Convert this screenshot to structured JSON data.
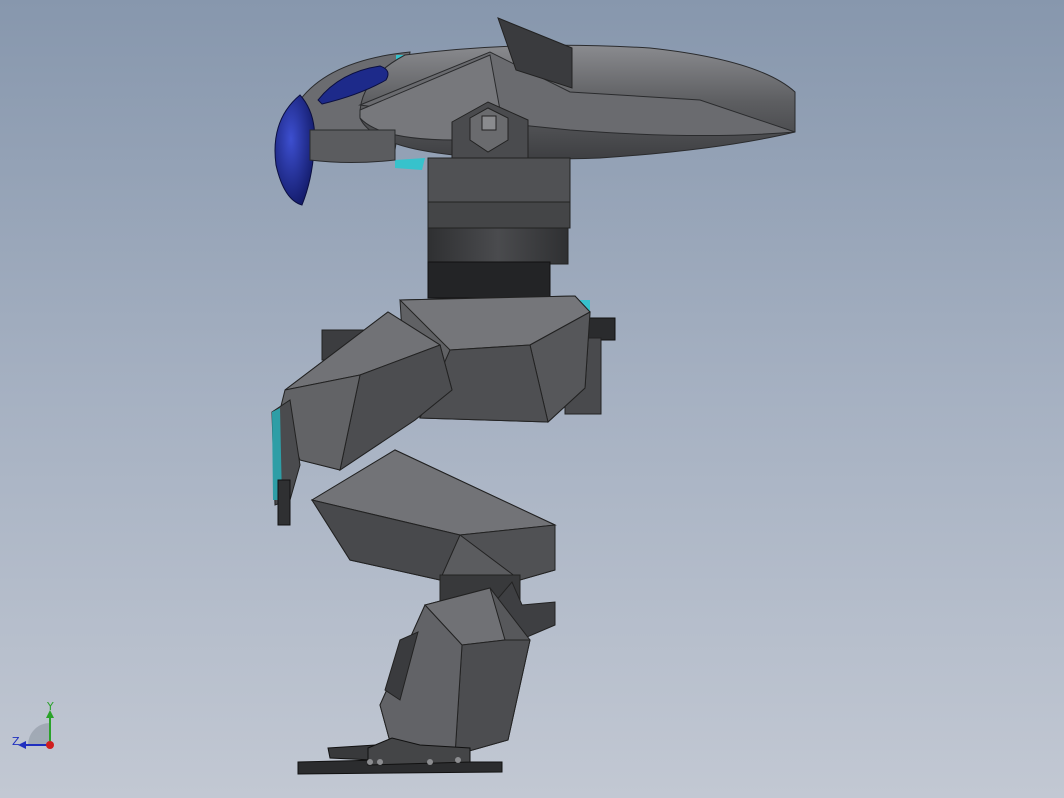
{
  "viewport": {
    "background_top": "#8797ad",
    "background_bottom": "#c2c8d3",
    "model_name": "mech-robot-side-view"
  },
  "model": {
    "primary_color": "#5b5c5f",
    "shadow_color": "#3a3b3d",
    "highlight_color": "#7b7c80",
    "accent_color": "#2e9ea6",
    "visor_color": "#1d2a8a"
  },
  "triad": {
    "y_label": "Y",
    "z_label": "Z",
    "y_color": "#2aa22a",
    "z_color": "#1f2fbf",
    "x_color": "#d01e1e"
  }
}
